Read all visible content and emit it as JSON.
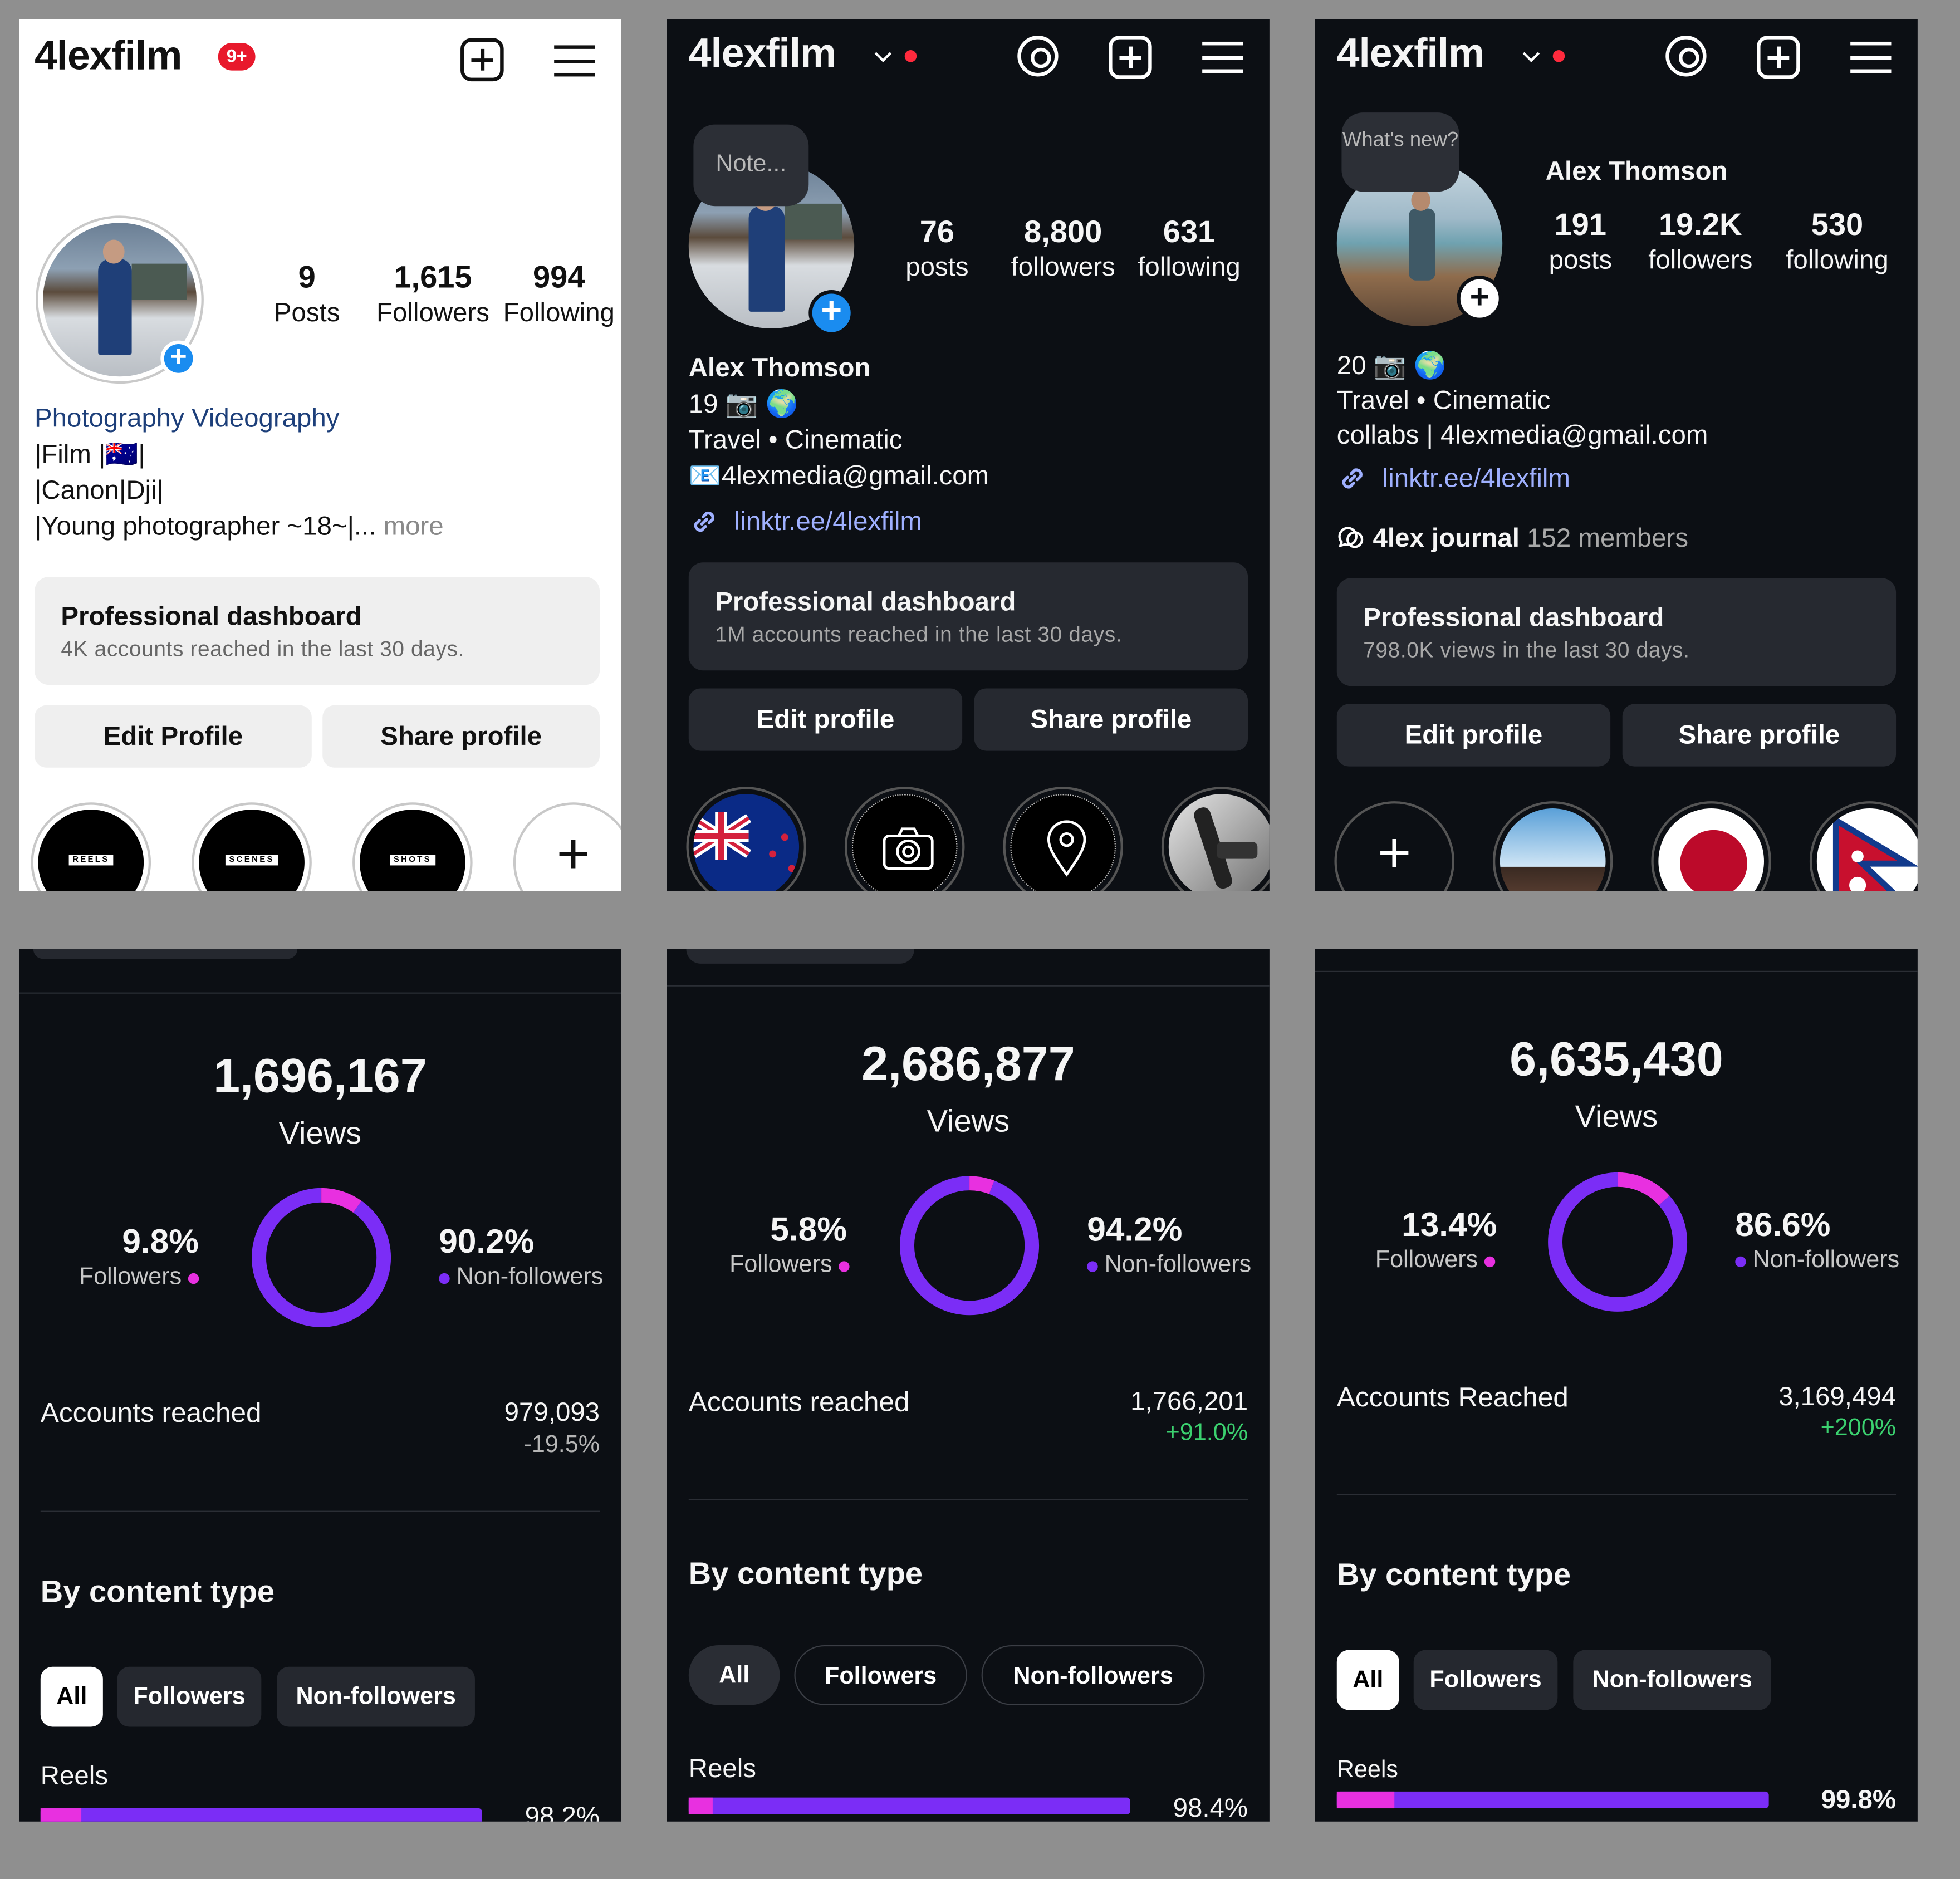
{
  "colors": {
    "accent_blue": "#1a8cf0",
    "followers_pink": "#e830e0",
    "nonfollowers_purple": "#7b2df6",
    "positive_green": "#3bd16f",
    "notification_red": "#e8192c",
    "link_blue": "#9fb0ff"
  },
  "icons": [
    "notification-badge",
    "new-post-icon",
    "menu-icon",
    "threads-icon",
    "chevron-down-icon",
    "add-story-icon",
    "link-icon",
    "channel-icon",
    "camera-emoji",
    "globe-emoji",
    "email-emoji"
  ],
  "p1": {
    "handle": "4lexfilm",
    "badge": "9+",
    "stats": [
      {
        "num": "9",
        "label": "Posts"
      },
      {
        "num": "1,615",
        "label": "Followers"
      },
      {
        "num": "994",
        "label": "Following"
      }
    ],
    "category": "Photography Videography",
    "bio": [
      "|Film |🇦🇺|",
      "|Canon|Dji|",
      "|Young photographer ~18~|..."
    ],
    "more": "more",
    "dash_title": "Professional dashboard",
    "dash_sub": "4K accounts reached in the last 30 days.",
    "edit": "Edit Profile",
    "share": "Share profile",
    "highlights": [
      "REELS",
      "SCENES",
      "SHOTS"
    ],
    "add": "+"
  },
  "p2": {
    "handle": "4lexfilm",
    "note": "Note...",
    "stats": [
      {
        "num": "76",
        "label": "posts"
      },
      {
        "num": "8,800",
        "label": "followers"
      },
      {
        "num": "631",
        "label": "following"
      }
    ],
    "name": "Alex Thomson",
    "bio": [
      "19 📷 🌍",
      "Travel • Cinematic",
      "📧4lexmedia@gmail.com"
    ],
    "link": "linktr.ee/4lexfilm",
    "dash_title": "Professional dashboard",
    "dash_sub": "1M accounts reached in the last 30 days.",
    "edit": "Edit profile",
    "share": "Share profile"
  },
  "p3": {
    "handle": "4lexfilm",
    "note": "What's new?",
    "name": "Alex Thomson",
    "stats": [
      {
        "num": "191",
        "label": "posts"
      },
      {
        "num": "19.2K",
        "label": "followers"
      },
      {
        "num": "530",
        "label": "following"
      }
    ],
    "bio": [
      "20 📷 🌍",
      "Travel • Cinematic",
      "collabs | 4lexmedia@gmail.com"
    ],
    "link": "linktr.ee/4lexfilm",
    "channel": "4lex journal",
    "channel_members": "152 members",
    "dash_title": "Professional dashboard",
    "dash_sub": "798.0K views in the last 30 days.",
    "edit": "Edit profile",
    "share": "Share profile",
    "add": "+"
  },
  "insights": [
    {
      "views": "1,696,167",
      "views_label": "Views",
      "followers_pct": "9.8%",
      "followers_label": "Followers",
      "nonfollowers_pct": "90.2%",
      "nonfollowers_label": "Non-followers",
      "followers_fraction": 0.098,
      "reached_label": "Accounts reached",
      "reached": "979,093",
      "change": "-19.5%",
      "change_type": "negative",
      "section": "By content type",
      "chips": [
        "All",
        "Followers",
        "Non-followers"
      ],
      "reels_label": "Reels",
      "reels_pct": "98.2%",
      "reels_fraction": 0.982
    },
    {
      "views": "2,686,877",
      "views_label": "Views",
      "followers_pct": "5.8%",
      "followers_label": "Followers",
      "nonfollowers_pct": "94.2%",
      "nonfollowers_label": "Non-followers",
      "followers_fraction": 0.058,
      "reached_label": "Accounts reached",
      "reached": "1,766,201",
      "change": "+91.0%",
      "change_type": "positive",
      "section": "By content type",
      "chips": [
        "All",
        "Followers",
        "Non-followers"
      ],
      "reels_label": "Reels",
      "reels_pct": "98.4%",
      "reels_fraction": 0.984
    },
    {
      "views": "6,635,430",
      "views_label": "Views",
      "followers_pct": "13.4%",
      "followers_label": "Followers",
      "nonfollowers_pct": "86.6%",
      "nonfollowers_label": "Non-followers",
      "followers_fraction": 0.134,
      "reached_label": "Accounts Reached",
      "reached": "3,169,494",
      "change": "+200%",
      "change_type": "positive",
      "section": "By content type",
      "chips": [
        "All",
        "Followers",
        "Non-followers"
      ],
      "reels_label": "Reels",
      "reels_pct": "99.8%",
      "reels_fraction": 0.998
    }
  ]
}
